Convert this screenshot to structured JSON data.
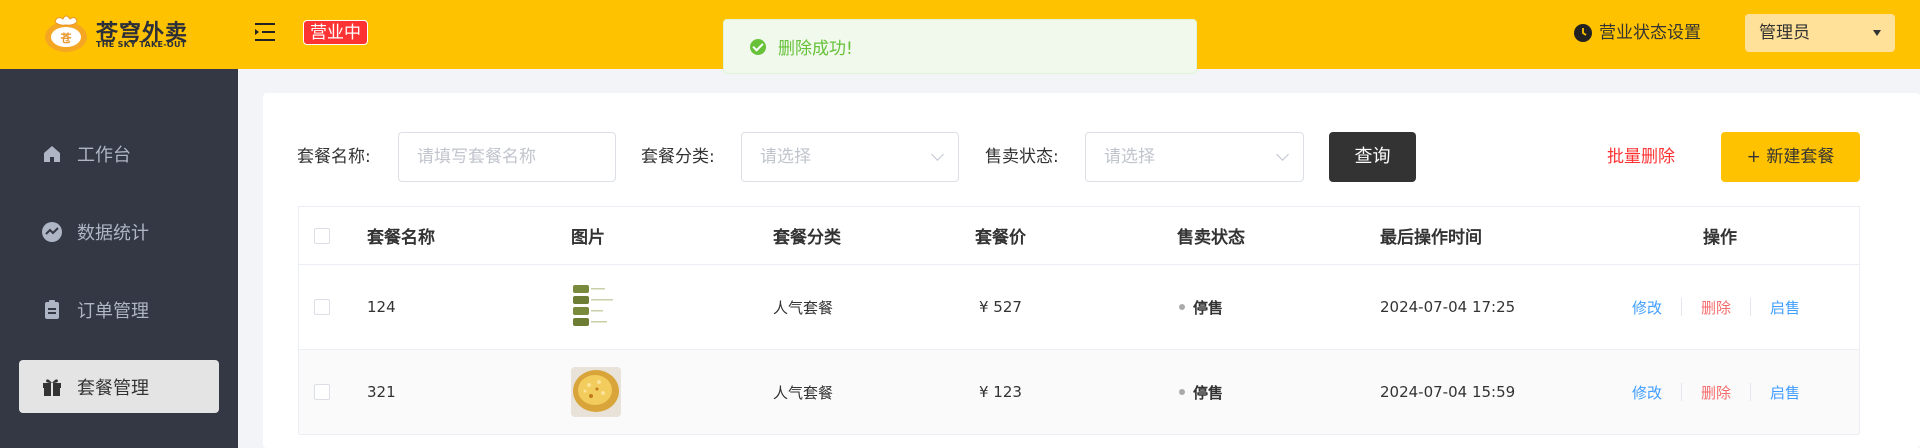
{
  "header": {
    "logo_name": "苍穹外卖",
    "logo_sub": "THE SKY TAKE-OUT",
    "logo_icon": "chef-logo-icon",
    "menu_icon": "menu-fold-icon",
    "status_tag": "营业中",
    "biz_settings": "营业状态设置",
    "biz_icon": "clock-icon",
    "user": "管理员"
  },
  "toast": {
    "message": "删除成功!",
    "icon": "success-check-icon",
    "color": "#67c23a"
  },
  "sidebar": {
    "items": [
      {
        "label": "工作台",
        "icon": "home-icon"
      },
      {
        "label": "数据统计",
        "icon": "chart-icon"
      },
      {
        "label": "订单管理",
        "icon": "clipboard-icon"
      },
      {
        "label": "套餐管理",
        "icon": "gift-icon",
        "active": true
      }
    ]
  },
  "filters": {
    "name_label": "套餐名称:",
    "name_placeholder": "请填写套餐名称",
    "category_label": "套餐分类:",
    "category_placeholder": "请选择",
    "status_label": "售卖状态:",
    "status_placeholder": "请选择",
    "query_button": "查询",
    "batch_delete": "批量删除",
    "new_button": "+ 新建套餐"
  },
  "table": {
    "columns": [
      "套餐名称",
      "图片",
      "套餐分类",
      "套餐价",
      "售卖状态",
      "最后操作时间",
      "操作"
    ],
    "rows": [
      {
        "name": "124",
        "category": "人气套餐",
        "price": "¥ 527",
        "status": "停售",
        "updated": "2024-07-04 17:25",
        "actions": [
          "修改",
          "删除",
          "启售"
        ]
      },
      {
        "name": "321",
        "category": "人气套餐",
        "price": "¥ 123",
        "status": "停售",
        "updated": "2024-07-04 15:59",
        "actions": [
          "修改",
          "删除",
          "启售"
        ]
      }
    ]
  },
  "colors": {
    "brand": "#ffc200",
    "sidebar": "#343744",
    "danger": "#fd3333",
    "link": "#419eff"
  }
}
